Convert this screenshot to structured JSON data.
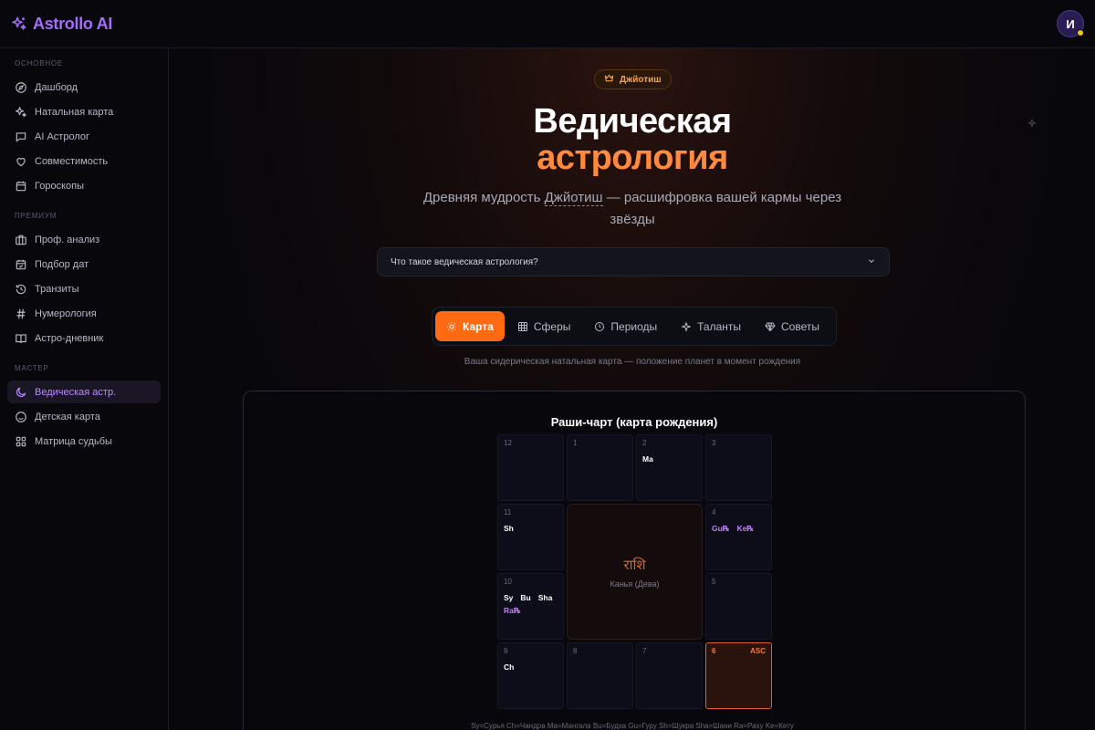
{
  "header": {
    "app_name": "Astrollo AI",
    "avatar_initial": "И"
  },
  "sidebar": {
    "sections": [
      {
        "title": "ОСНОВНОЕ",
        "items": [
          {
            "label": "Дашборд",
            "icon": "compass-icon"
          },
          {
            "label": "Натальная карта",
            "icon": "sparkles-icon"
          },
          {
            "label": "AI Астролог",
            "icon": "chat-icon"
          },
          {
            "label": "Совместимость",
            "icon": "heart-icon"
          },
          {
            "label": "Гороскопы",
            "icon": "calendar-icon"
          }
        ]
      },
      {
        "title": "ПРЕМИУМ",
        "items": [
          {
            "label": "Проф. анализ",
            "icon": "briefcase-icon"
          },
          {
            "label": "Подбор дат",
            "icon": "calendar-check-icon"
          },
          {
            "label": "Транзиты",
            "icon": "history-icon"
          },
          {
            "label": "Нумерология",
            "icon": "hash-icon"
          },
          {
            "label": "Астро-дневник",
            "icon": "book-icon"
          }
        ]
      },
      {
        "title": "МАСТЕР",
        "items": [
          {
            "label": "Ведическая астр.",
            "icon": "moon-icon",
            "active": true
          },
          {
            "label": "Детская карта",
            "icon": "smile-icon"
          },
          {
            "label": "Матрица судьбы",
            "icon": "grid-icon"
          }
        ]
      }
    ]
  },
  "hero": {
    "badge": "Джйотиш",
    "title_line1": "Ведическая",
    "title_line2": "астрология",
    "subtitle_before": "Древняя мудрость ",
    "subtitle_term": "Джйотиш",
    "subtitle_after": " — расшифровка вашей кармы через звёзды"
  },
  "accordion": {
    "label": "Что такое ведическая астрология?"
  },
  "tabs": [
    {
      "label": "Карта",
      "icon": "sun-icon",
      "active": true
    },
    {
      "label": "Сферы",
      "icon": "table-icon"
    },
    {
      "label": "Периоды",
      "icon": "clock-icon"
    },
    {
      "label": "Таланты",
      "icon": "sparkle-icon"
    },
    {
      "label": "Советы",
      "icon": "diamond-icon"
    }
  ],
  "tab_caption": "Ваша сидерическая натальная карта — положение планет в момент рождения",
  "chart": {
    "title": "Раши-чарт (карта рождения)",
    "center_script": "राशि",
    "center_sign": "Канья (Дева)",
    "asc_label": "ASC",
    "houses": {
      "12": [],
      "1": [],
      "2": [
        [
          "Ma"
        ]
      ],
      "3": [],
      "11": [
        [
          "Sh"
        ]
      ],
      "4": [
        [
          "Gu℞",
          "Ke℞"
        ]
      ],
      "10": [
        [
          "Sy",
          "Bu",
          "Sha"
        ],
        [
          "Ra℞"
        ]
      ],
      "5": [],
      "9": [
        [
          "Ch"
        ]
      ],
      "8": [],
      "7": [],
      "6": []
    },
    "legend": "Sy=Сурья Ch=Чандра Ma=Мангала Bu=Будха   Gu=Гуру Sh=Шукра Sha=Шани Ra=Раху Ke=Кету"
  }
}
